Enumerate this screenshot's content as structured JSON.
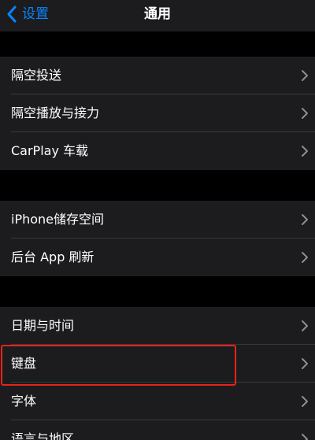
{
  "nav": {
    "back_label": "设置",
    "title": "通用",
    "back_icon": "chevron-left-icon"
  },
  "groups": [
    {
      "items": [
        {
          "label": "隔空投送"
        },
        {
          "label": "隔空播放与接力"
        },
        {
          "label": "CarPlay 车载"
        }
      ]
    },
    {
      "items": [
        {
          "label": "iPhone储存空间"
        },
        {
          "label": "后台 App 刷新"
        }
      ]
    },
    {
      "items": [
        {
          "label": "日期与时间"
        },
        {
          "label": "键盘"
        },
        {
          "label": "字体"
        },
        {
          "label": "语言与地区"
        }
      ]
    }
  ],
  "colors": {
    "accent": "#0a84ff",
    "highlight": "#e8221c",
    "row_background": "#1c1c1e",
    "page_background": "#000000"
  },
  "row_icon": "chevron-right-icon"
}
